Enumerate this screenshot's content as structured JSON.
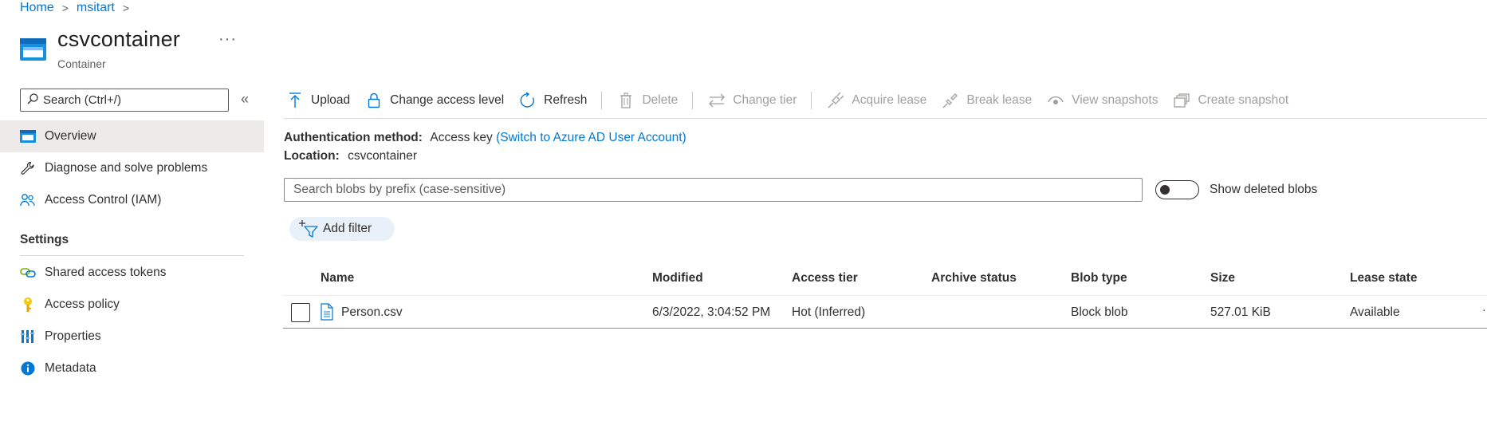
{
  "breadcrumb": {
    "home": "Home",
    "account": "msitart",
    "sep": ">"
  },
  "header": {
    "title": "csvcontainer",
    "subtitle": "Container",
    "more": "···"
  },
  "sidebar": {
    "search_placeholder": "Search (Ctrl+/)",
    "collapse": "«",
    "items": [
      {
        "label": "Overview",
        "icon": "overview-icon",
        "active": true
      },
      {
        "label": "Diagnose and solve problems",
        "icon": "wrench-icon"
      },
      {
        "label": "Access Control (IAM)",
        "icon": "people-icon"
      }
    ],
    "settings_heading": "Settings",
    "settings_items": [
      {
        "label": "Shared access tokens",
        "icon": "link-icon"
      },
      {
        "label": "Access policy",
        "icon": "key-icon"
      },
      {
        "label": "Properties",
        "icon": "properties-icon"
      },
      {
        "label": "Metadata",
        "icon": "info-icon"
      }
    ]
  },
  "toolbar": {
    "upload": "Upload",
    "change_access": "Change access level",
    "refresh": "Refresh",
    "delete": "Delete",
    "change_tier": "Change tier",
    "acquire_lease": "Acquire lease",
    "break_lease": "Break lease",
    "view_snapshots": "View snapshots",
    "create_snapshot": "Create snapshot"
  },
  "info": {
    "auth_label": "Authentication method:",
    "auth_value": "Access key",
    "auth_link": "(Switch to Azure AD User Account)",
    "location_label": "Location:",
    "location_value": "csvcontainer"
  },
  "blob_search": {
    "placeholder": "Search blobs by prefix (case-sensitive)"
  },
  "show_deleted": {
    "label": "Show deleted blobs",
    "on": false
  },
  "filter": {
    "label": "Add filter"
  },
  "table": {
    "columns": [
      "Name",
      "Modified",
      "Access tier",
      "Archive status",
      "Blob type",
      "Size",
      "Lease state"
    ],
    "rows": [
      {
        "name": "Person.csv",
        "modified": "6/3/2022, 3:04:52 PM",
        "access_tier": "Hot (Inferred)",
        "archive_status": "",
        "blob_type": "Block blob",
        "size": "527.01 KiB",
        "lease_state": "Available",
        "more": "···"
      }
    ]
  },
  "colors": {
    "accent": "#0078d4",
    "text": "#323130",
    "disabled": "#a19f9d",
    "active_bg": "#edebe9",
    "pill_bg": "#e8f1fa"
  }
}
